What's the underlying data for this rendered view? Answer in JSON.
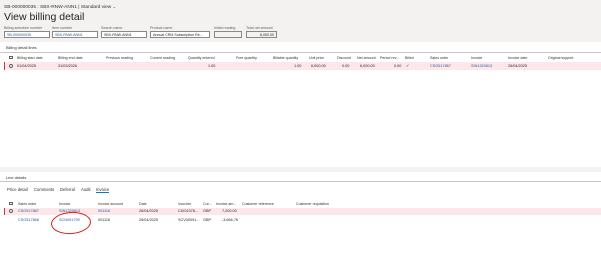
{
  "breadcrumb": "SB-000000035 : SBX-RNW-ANN1  |  Standard view",
  "page_title": "View billing detail",
  "header_fields": [
    {
      "label": "Billing schedule number",
      "value": "SB-000000035"
    },
    {
      "label": "Item number",
      "value": "SBX-RNW-ANN1"
    },
    {
      "label": "Search name",
      "value": "SBX-RNW-ANN1"
    },
    {
      "label": "Product name",
      "value": "Annual CRM Subscription Re..."
    },
    {
      "label": "Initial reading",
      "value": ""
    },
    {
      "label": "Total net amount",
      "value": "6,000.00"
    }
  ],
  "billing_lines": {
    "title": "Billing detail lines",
    "columns": [
      "Billing start date",
      "Billing end date",
      "Previous reading",
      "Current reading",
      "Quantity entered",
      "Free quantity",
      "Billable quantity",
      "Unit price",
      "Discount",
      "Net amount",
      "Period rev...",
      "Billed",
      "Sales order",
      "Invoice",
      "Invoice date",
      "Original support"
    ],
    "rows": [
      {
        "start": "01/04/2025",
        "end": "31/03/2026",
        "prev": "",
        "curr": "",
        "qty": "1.00",
        "free": "",
        "billable": "1.00",
        "price": "6,000.00",
        "discount": "0.00",
        "net": "6,000.00",
        "period": "0.00",
        "billed": "✓",
        "so": "CSO517867",
        "invoice": "SIN1329813",
        "invdate": "26/04/2025",
        "orig": ""
      }
    ]
  },
  "line_details": {
    "title": "Line details",
    "tabs": [
      "Price detail",
      "Comments",
      "Deferral",
      "Audit",
      "Invoice"
    ],
    "active_tab": "Invoice",
    "columns": [
      "Sales order",
      "Invoice",
      "Invoice account",
      "Date",
      "Voucher",
      "Cur...",
      "Invoice am...",
      "Customer reference",
      "Customer requisition"
    ],
    "rows": [
      {
        "so": "CSO517867",
        "invoice": "SIN1329813",
        "account": "001116",
        "date": "26/04/2025",
        "voucher": "CIV01378...",
        "cur": "GBP",
        "amount": "7,200.00",
        "ref": "",
        "req": ""
      },
      {
        "so": "CSO517868",
        "invoice": "SCN091799",
        "account": "001116",
        "date": "26/04/2025",
        "voucher": "SCV00091...",
        "cur": "GBP",
        "amount": "-3,666.76",
        "ref": "",
        "req": ""
      }
    ]
  },
  "colors": {
    "link": "#2b579a",
    "selected_row": "#fde7e9",
    "annotation": "#d81e1e",
    "accent": "#0078d4"
  },
  "icons": [
    "chevron-down-icon",
    "checkmark-icon"
  ]
}
